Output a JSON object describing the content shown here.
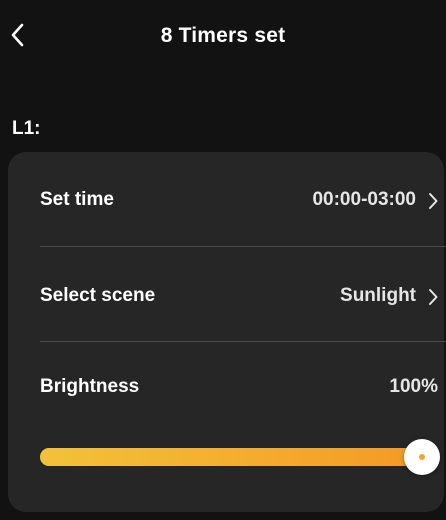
{
  "header": {
    "title": "8 Timers set",
    "back_icon": "chevron-left-icon"
  },
  "section": {
    "label": "L1:"
  },
  "settings": {
    "set_time": {
      "label": "Set time",
      "value": "00:00-03:00"
    },
    "select_scene": {
      "label": "Select scene",
      "value": "Sunlight"
    },
    "brightness": {
      "label": "Brightness",
      "value": "100%",
      "level_percent": 100
    }
  },
  "colors": {
    "background": "#121212",
    "card": "#262626",
    "accent": "#f2a52a",
    "divider": "#4a4a4a"
  }
}
